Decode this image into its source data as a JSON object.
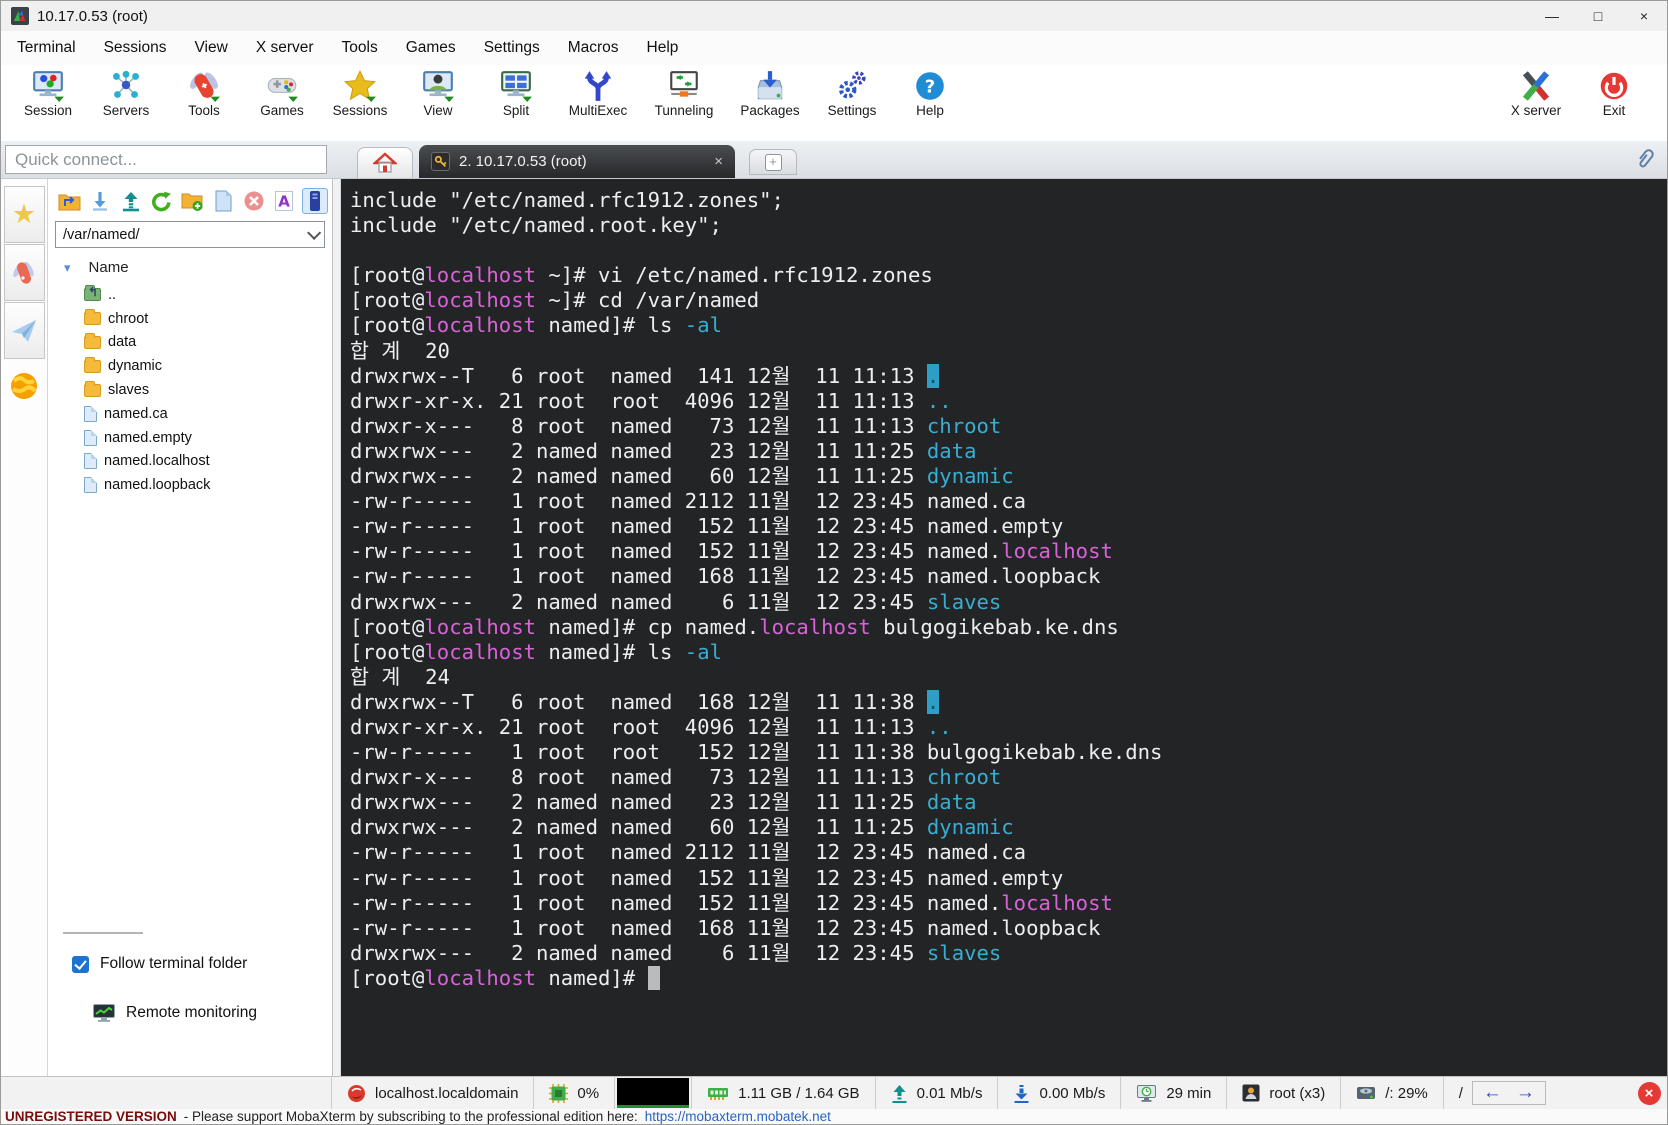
{
  "window": {
    "title": "10.17.0.53 (root)",
    "controls": {
      "minimize": "—",
      "maximize": "□",
      "close": "×"
    }
  },
  "menu": [
    "Terminal",
    "Sessions",
    "View",
    "X server",
    "Tools",
    "Games",
    "Settings",
    "Macros",
    "Help"
  ],
  "toolbar": {
    "items": [
      {
        "label": "Session"
      },
      {
        "label": "Servers"
      },
      {
        "label": "Tools"
      },
      {
        "label": "Games"
      },
      {
        "label": "Sessions"
      },
      {
        "label": "View"
      },
      {
        "label": "Split"
      },
      {
        "label": "MultiExec"
      },
      {
        "label": "Tunneling"
      },
      {
        "label": "Packages"
      },
      {
        "label": "Settings"
      },
      {
        "label": "Help"
      }
    ],
    "right_items": [
      {
        "label": "X server"
      },
      {
        "label": "Exit"
      }
    ]
  },
  "tab_bar": {
    "quick_connect_placeholder": "Quick connect...",
    "active_tab": "2. 10.17.0.53 (root)"
  },
  "icons": {
    "close_tab": "×",
    "new_tab": "+",
    "sort": "▾",
    "star": "★",
    "back_arrow": "←",
    "forward_arrow": "→",
    "close_status": "×"
  },
  "sidebar": {
    "path_value": "/var/named/",
    "tree_header": "Name",
    "tree_items": [
      {
        "name": "..",
        "type": "folder-up"
      },
      {
        "name": "chroot",
        "type": "folder"
      },
      {
        "name": "data",
        "type": "folder"
      },
      {
        "name": "dynamic",
        "type": "folder"
      },
      {
        "name": "slaves",
        "type": "folder"
      },
      {
        "name": "named.ca",
        "type": "file"
      },
      {
        "name": "named.empty",
        "type": "file"
      },
      {
        "name": "named.localhost",
        "type": "file"
      },
      {
        "name": "named.loopback",
        "type": "file"
      }
    ],
    "follow_label": "Follow terminal folder",
    "follow_checked": true,
    "remote_monitoring_label": "Remote monitoring"
  },
  "terminal": {
    "colors": {
      "bg": "#222426",
      "fg": "#eceef0",
      "magenta": "#d863d8",
      "cyan": "#37aed3",
      "cursor": "#b9bcbf",
      "dir_block_bg": "#2d9fc4"
    },
    "lines": [
      [
        {
          "t": "include \"/etc/named.rfc1912.zones\";"
        }
      ],
      [
        {
          "t": "include \"/etc/named.root.key\";"
        }
      ],
      [
        {
          "t": ""
        }
      ],
      [
        {
          "t": "[root@"
        },
        {
          "t": "localhost",
          "c": "m"
        },
        {
          "t": " ~]# vi /etc/named.rfc1912.zones"
        }
      ],
      [
        {
          "t": "[root@"
        },
        {
          "t": "localhost",
          "c": "m"
        },
        {
          "t": " ~]# cd /var/named"
        }
      ],
      [
        {
          "t": "[root@"
        },
        {
          "t": "localhost",
          "c": "m"
        },
        {
          "t": " named]# ls "
        },
        {
          "t": "-al",
          "c": "c"
        }
      ],
      [
        {
          "t": "합 계  20"
        }
      ],
      [
        {
          "t": "drwxrwx--T   6 root  named  141 12월  11 11:13 "
        },
        {
          "t": ".",
          "c": "d"
        }
      ],
      [
        {
          "t": "drwxr-xr-x. 21 root  root  4096 12월  11 11:13 "
        },
        {
          "t": "..",
          "c": "c"
        }
      ],
      [
        {
          "t": "drwxr-x---   8 root  named   73 12월  11 11:13 "
        },
        {
          "t": "chroot",
          "c": "c"
        }
      ],
      [
        {
          "t": "drwxrwx---   2 named named   23 12월  11 11:25 "
        },
        {
          "t": "data",
          "c": "c"
        }
      ],
      [
        {
          "t": "drwxrwx---   2 named named   60 12월  11 11:25 "
        },
        {
          "t": "dynamic",
          "c": "c"
        }
      ],
      [
        {
          "t": "-rw-r-----   1 root  named 2112 11월  12 23:45 named.ca"
        }
      ],
      [
        {
          "t": "-rw-r-----   1 root  named  152 11월  12 23:45 named.empty"
        }
      ],
      [
        {
          "t": "-rw-r-----   1 root  named  152 11월  12 23:45 named."
        },
        {
          "t": "localhost",
          "c": "m"
        }
      ],
      [
        {
          "t": "-rw-r-----   1 root  named  168 11월  12 23:45 named.loopback"
        }
      ],
      [
        {
          "t": "drwxrwx---   2 named named    6 11월  12 23:45 "
        },
        {
          "t": "slaves",
          "c": "c"
        }
      ],
      [
        {
          "t": "[root@"
        },
        {
          "t": "localhost",
          "c": "m"
        },
        {
          "t": " named]# cp named."
        },
        {
          "t": "localhost",
          "c": "m"
        },
        {
          "t": " bulgogikebab.ke.dns"
        }
      ],
      [
        {
          "t": "[root@"
        },
        {
          "t": "localhost",
          "c": "m"
        },
        {
          "t": " named]# ls "
        },
        {
          "t": "-al",
          "c": "c"
        }
      ],
      [
        {
          "t": "합 계  24"
        }
      ],
      [
        {
          "t": "drwxrwx--T   6 root  named  168 12월  11 11:38 "
        },
        {
          "t": ".",
          "c": "d"
        }
      ],
      [
        {
          "t": "drwxr-xr-x. 21 root  root  4096 12월  11 11:13 "
        },
        {
          "t": "..",
          "c": "c"
        }
      ],
      [
        {
          "t": "-rw-r-----   1 root  root   152 12월  11 11:38 bulgogikebab.ke.dns"
        }
      ],
      [
        {
          "t": "drwxr-x---   8 root  named   73 12월  11 11:13 "
        },
        {
          "t": "chroot",
          "c": "c"
        }
      ],
      [
        {
          "t": "drwxrwx---   2 named named   23 12월  11 11:25 "
        },
        {
          "t": "data",
          "c": "c"
        }
      ],
      [
        {
          "t": "drwxrwx---   2 named named   60 12월  11 11:25 "
        },
        {
          "t": "dynamic",
          "c": "c"
        }
      ],
      [
        {
          "t": "-rw-r-----   1 root  named 2112 11월  12 23:45 named.ca"
        }
      ],
      [
        {
          "t": "-rw-r-----   1 root  named  152 11월  12 23:45 named.empty"
        }
      ],
      [
        {
          "t": "-rw-r-----   1 root  named  152 11월  12 23:45 named."
        },
        {
          "t": "localhost",
          "c": "m"
        }
      ],
      [
        {
          "t": "-rw-r-----   1 root  named  168 11월  12 23:45 named.loopback"
        }
      ],
      [
        {
          "t": "drwxrwx---   2 named named    6 11월  12 23:45 "
        },
        {
          "t": "slaves",
          "c": "c"
        }
      ],
      [
        {
          "t": "[root@"
        },
        {
          "t": "localhost",
          "c": "m"
        },
        {
          "t": " named]# "
        },
        {
          "t": " ",
          "c": "k"
        }
      ]
    ]
  },
  "status_bar": {
    "host": "localhost.localdomain",
    "cpu": "0%",
    "ram": "1.11 GB / 1.64 GB",
    "upload": "0.01 Mb/s",
    "download": "0.00 Mb/s",
    "uptime": "29 min",
    "user": "root (x3)",
    "disk": "/: 29%",
    "nav_slash": "/"
  },
  "footer": {
    "version_label": "UNREGISTERED VERSION",
    "message": "-  Please support MobaXterm by subscribing to the professional edition here:",
    "link": "https://mobaxterm.mobatek.net"
  }
}
